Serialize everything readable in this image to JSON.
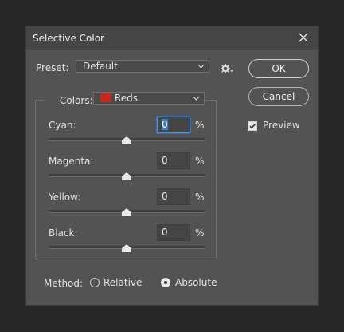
{
  "dialog": {
    "title": "Selective Color",
    "close_icon": "close-icon"
  },
  "preset": {
    "label": "Preset:",
    "value": "Default"
  },
  "buttons": {
    "ok": "OK",
    "cancel": "Cancel"
  },
  "preview": {
    "label": "Preview",
    "checked": true
  },
  "colors": {
    "label": "Colors:",
    "value": "Reds",
    "swatch_color": "#c8281a"
  },
  "sliders": [
    {
      "label": "Cyan:",
      "value": "0",
      "unit": "%",
      "level": 0.5
    },
    {
      "label": "Magenta:",
      "value": "0",
      "unit": "%",
      "level": 0.5
    },
    {
      "label": "Yellow:",
      "value": "0",
      "unit": "%",
      "level": 0.5
    },
    {
      "label": "Black:",
      "value": "0",
      "unit": "%",
      "level": 0.5
    }
  ],
  "method": {
    "label": "Method:",
    "options": [
      "Relative",
      "Absolute"
    ],
    "selected": "Absolute"
  }
}
